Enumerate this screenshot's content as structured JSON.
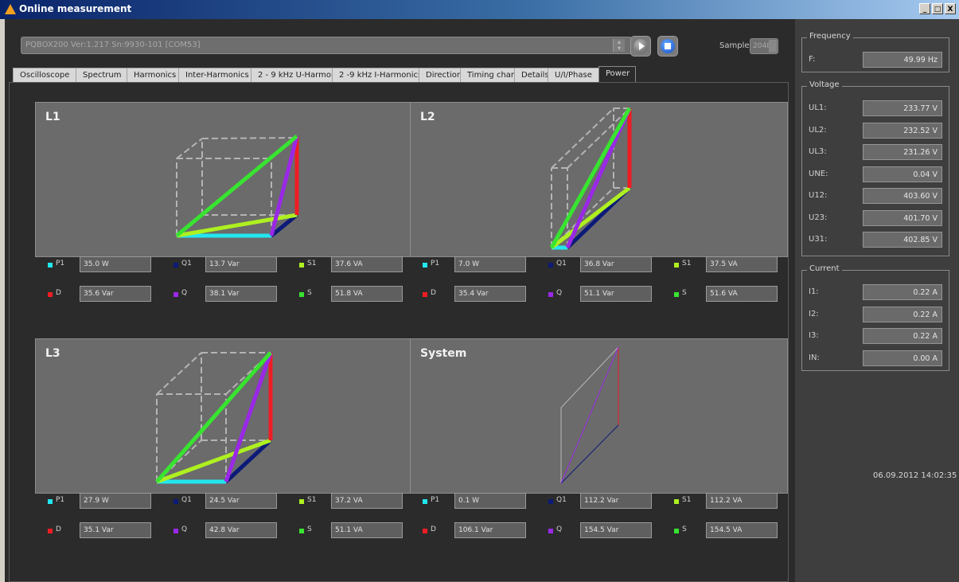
{
  "window": {
    "title": "Online measurement",
    "minimize": "_",
    "restore": "□",
    "close": "X"
  },
  "device": {
    "value": "PQBOX200 Ver:1.217 Sn:9930-101 [COM53]"
  },
  "sample": {
    "label": "Sample:",
    "value": "2048"
  },
  "tabs": [
    "Oscilloscope",
    "Spectrum",
    "Harmonics",
    "Inter-Harmonics",
    "2 - 9 kHz U-Harmonics",
    "2 -9 kHz I-Harmonics",
    "Direction",
    "Timing chart",
    "Details",
    "U/I/Phase",
    "Power"
  ],
  "active_tab": "Power",
  "colors": {
    "P1": "#22e6ee",
    "Q1": "#0c1a78",
    "S1": "#aef020",
    "D": "#ee1c24",
    "Q": "#9a28e6",
    "S": "#38e430"
  },
  "panels": [
    {
      "title": "L1",
      "vals": {
        "P1": "35.0 W",
        "Q1": "13.7 Var",
        "S1": "37.6 VA",
        "D": "35.6 Var",
        "Q": "38.1 Var",
        "S": "51.8 VA"
      }
    },
    {
      "title": "L2",
      "vals": {
        "P1": "7.0 W",
        "Q1": "36.8 Var",
        "S1": "37.5 VA",
        "D": "35.4 Var",
        "Q": "51.1 Var",
        "S": "51.6 VA"
      }
    },
    {
      "title": "L3",
      "vals": {
        "P1": "27.9 W",
        "Q1": "24.5 Var",
        "S1": "37.2 VA",
        "D": "35.1 Var",
        "Q": "42.8 Var",
        "S": "51.1 VA"
      }
    },
    {
      "title": "System",
      "vals": {
        "P1": "0.1 W",
        "Q1": "112.2 Var",
        "S1": "112.2 VA",
        "D": "106.1 Var",
        "Q": "154.5 Var",
        "S": "154.5 VA"
      }
    }
  ],
  "legend_names": {
    "P1": "P1",
    "Q1": "Q1",
    "S1": "S1",
    "D": "D",
    "Q": "Q",
    "S": "S"
  },
  "frequency": {
    "title": "Frequency",
    "rows": [
      {
        "label": "F:",
        "value": "49.99 Hz"
      }
    ]
  },
  "voltage": {
    "title": "Voltage",
    "rows": [
      {
        "label": "UL1:",
        "value": "233.77 V"
      },
      {
        "label": "UL2:",
        "value": "232.52 V"
      },
      {
        "label": "UL3:",
        "value": "231.26 V"
      },
      {
        "label": "UNE:",
        "value": "0.04 V"
      },
      {
        "label": "U12:",
        "value": "403.60 V"
      },
      {
        "label": "U23:",
        "value": "401.70 V"
      },
      {
        "label": "U31:",
        "value": "402.85 V"
      }
    ]
  },
  "current": {
    "title": "Current",
    "rows": [
      {
        "label": "I1:",
        "value": "0.22 A"
      },
      {
        "label": "I2:",
        "value": "0.22 A"
      },
      {
        "label": "I3:",
        "value": "0.22 A"
      },
      {
        "label": "IN:",
        "value": "0.00 A"
      }
    ]
  },
  "timestamp": "06.09.2012 14:02:35"
}
